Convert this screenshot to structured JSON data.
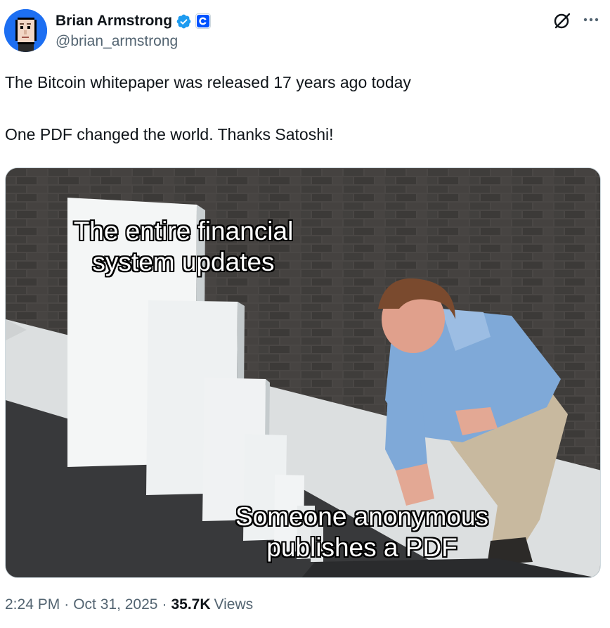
{
  "author": {
    "display_name": "Brian Armstrong",
    "handle": "@brian_armstrong",
    "verified_color": "#1d9bf0",
    "affiliate_badge": "coinbase-badge-icon",
    "avatar": "pixel-avatar-icon"
  },
  "header_actions": {
    "grok_icon": "grok-icon",
    "more_icon": "more-options-icon"
  },
  "tweet": {
    "line1": "The Bitcoin whitepaper was released 17 years ago today",
    "line2": "One PDF changed the world. Thanks Satoshi!"
  },
  "media": {
    "top_caption_1": "The entire financial",
    "top_caption_2": "system updates",
    "bottom_caption_1": "Someone anonymous",
    "bottom_caption_2": "publishes a PDF"
  },
  "footer": {
    "time": "2:24 PM",
    "separator": "·",
    "date": "Oct 31, 2025",
    "views_count": "35.7K",
    "views_label": "Views"
  },
  "colors": {
    "text_primary": "#0f1419",
    "text_secondary": "#536471",
    "accent": "#1d9bf0",
    "coinbase_blue": "#0052ff"
  }
}
